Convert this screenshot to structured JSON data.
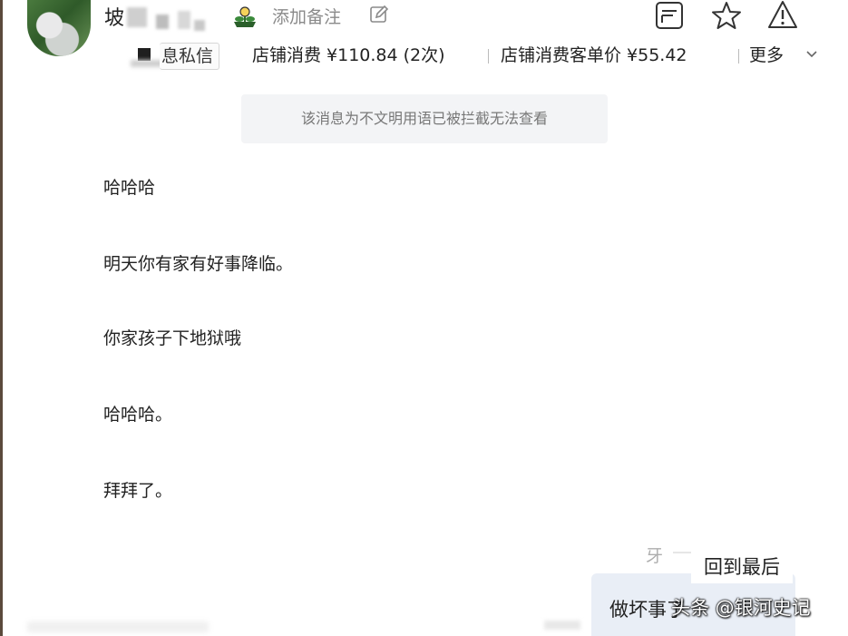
{
  "header": {
    "name_visible": "坡",
    "add_note_label": "添加备注",
    "icons": [
      "flower-icon",
      "edit-icon",
      "note-icon",
      "star-icon",
      "warning-icon"
    ]
  },
  "info_bar": {
    "tag_label": "息私信",
    "stat1": "店铺消费 ¥110.84 (2次)",
    "stat2": "店铺消费客单价 ¥55.42",
    "more_label": "更多"
  },
  "chat": {
    "blocked_notice": "该消息为不文明用语已被拦截无法查看",
    "messages": [
      "哈哈哈",
      "明天你有家有好事降临。",
      "你家孩子下地狱哦",
      "哈哈哈。",
      "拜拜了。"
    ],
    "faint_text": "牙",
    "back_to_bottom_label": "回到最后",
    "sent_partial": "做坏事了"
  },
  "watermark": "头条 @银河史记",
  "colors": {
    "blocked_bg": "#f3f4f6",
    "sent_bubble_bg": "#e9eef6",
    "muted_text": "#8a8a8a"
  }
}
